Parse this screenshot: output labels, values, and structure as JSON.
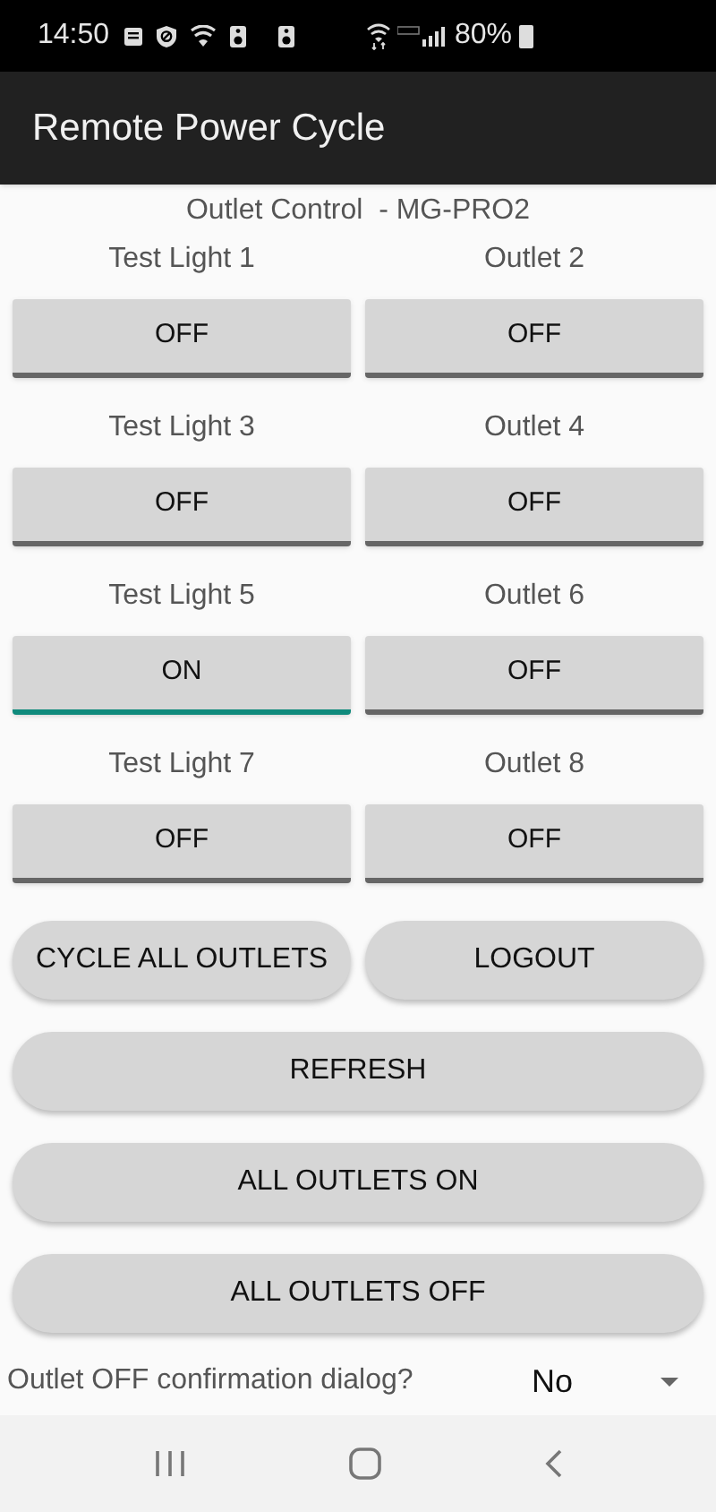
{
  "status_bar": {
    "time": "14:50",
    "battery": "80%"
  },
  "app_bar": {
    "title": "Remote Power Cycle"
  },
  "subtitle": "Outlet Control  - MG-PRO2",
  "outlets": [
    {
      "name": "Test Light 1",
      "label": "OFF",
      "on": false
    },
    {
      "name": "Outlet 2",
      "label": "OFF",
      "on": false
    },
    {
      "name": "Test Light 3",
      "label": "OFF",
      "on": false
    },
    {
      "name": "Outlet 4",
      "label": "OFF",
      "on": false
    },
    {
      "name": "Test Light 5",
      "label": "ON",
      "on": true
    },
    {
      "name": "Outlet 6",
      "label": "OFF",
      "on": false
    },
    {
      "name": "Test Light 7",
      "label": "OFF",
      "on": false
    },
    {
      "name": "Outlet 8",
      "label": "OFF",
      "on": false
    }
  ],
  "action_rows": [
    [
      "CYCLE ALL OUTLETS",
      "LOGOUT"
    ],
    [
      "REFRESH"
    ],
    [
      "ALL OUTLETS ON"
    ],
    [
      "ALL OUTLETS OFF"
    ]
  ],
  "setting": {
    "label": "Outlet OFF confirmation dialog?",
    "value": "No"
  }
}
